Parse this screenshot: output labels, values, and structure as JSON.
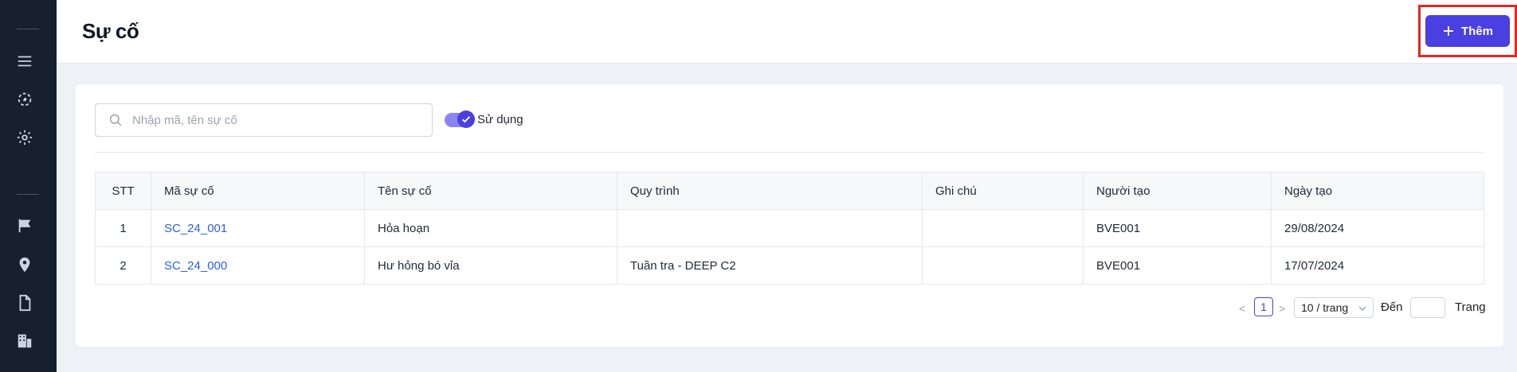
{
  "header": {
    "title": "Sự cố",
    "add_label": "Thêm"
  },
  "search": {
    "placeholder": "Nhập mã, tên sự cố",
    "value": ""
  },
  "filter": {
    "toggle_label": "Sử dụng",
    "toggle_on": true
  },
  "table": {
    "columns": [
      "STT",
      "Mã sự cố",
      "Tên sự cố",
      "Quy trình",
      "Ghi chú",
      "Người tạo",
      "Ngày tạo"
    ],
    "rows": [
      {
        "stt": "1",
        "code": "SC_24_001",
        "name": "Hỏa hoạn",
        "process": "",
        "note": "",
        "creator": "BVE001",
        "date": "29/08/2024"
      },
      {
        "stt": "2",
        "code": "SC_24_000",
        "name": "Hư hỏng bó vỉa",
        "process": "Tuần tra - DEEP C2",
        "note": "",
        "creator": "BVE001",
        "date": "17/07/2024"
      }
    ]
  },
  "pagination": {
    "prev": "<",
    "current_page": "1",
    "next": ">",
    "page_size": "10 / trang",
    "goto_label": "Đến",
    "page_label": "Trang"
  },
  "colors": {
    "accent": "#4a3fe0",
    "sidebar": "#16202e",
    "link": "#2b5fd9",
    "highlight": "#e0281e"
  },
  "icons": {
    "sidebar": [
      "menu-icon",
      "dashboard-icon",
      "settings-icon",
      "flag-icon",
      "location-icon",
      "document-icon",
      "building-icon"
    ],
    "header": [
      "plus-icon",
      "refresh-icon"
    ],
    "search": "search-icon"
  }
}
